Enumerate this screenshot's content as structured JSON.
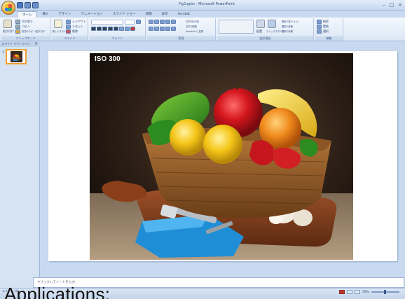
{
  "window": {
    "title": "Fig3.pptx - Microsoft PowerPoint",
    "controls": [
      "–",
      "□",
      "×"
    ]
  },
  "ribbon": {
    "tabs": [
      "ホーム",
      "挿入",
      "デザイン",
      "アニメーション",
      "スライド ショー",
      "校閲",
      "表示",
      "Acrobat"
    ],
    "active_tab": "ホーム",
    "groups": [
      "クリップボード",
      "スライド",
      "フォント",
      "段落",
      "図形描画",
      "編集"
    ],
    "clipboard": {
      "cut": "切り取り",
      "copy": "コピー",
      "format_painter": "書式のコピー/貼り付け",
      "paste": "貼り付け"
    },
    "slides": {
      "new_slide": "新しいスライド",
      "layout": "レイアウト",
      "reset": "リセット",
      "delete": "削除"
    },
    "paragraph": {
      "text_direction": "文字列の方向",
      "align_text": "文字の配置",
      "smartart": "SmartArt に変換"
    },
    "drawing": {
      "arrange": "配置",
      "quick_styles": "クイックスタイル",
      "fill": "図形の塗りつぶし",
      "outline": "図形の枠線",
      "effects": "図形の効果"
    },
    "editing": {
      "find": "検索",
      "replace": "置換",
      "select": "選択"
    }
  },
  "left_pane": {
    "tab_label": "スライド アウトライン",
    "slide_number": "1"
  },
  "slide": {
    "image_caption": "ISO 300"
  },
  "notes": {
    "placeholder": "クリックしてノートを入力"
  },
  "status_bar": {
    "left": "スライド 1/1",
    "zoom": "59%"
  },
  "overlay": {
    "text": "Applications:"
  }
}
